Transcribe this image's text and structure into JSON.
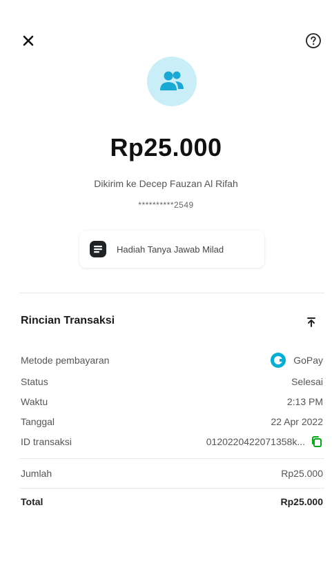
{
  "header": {
    "close_icon": "close-icon",
    "help_icon": "help-circle-icon"
  },
  "hero": {
    "avatar_icon": "people-icon",
    "avatar_color": "#c9eef8",
    "icon_color": "#1aa8d4",
    "amount": "Rp25.000",
    "recipient": "Dikirim ke Decep Fauzan Al Rifah",
    "account_masked": "**********2549"
  },
  "note": {
    "icon": "note-icon",
    "text": "Hadiah Tanya Jawab Milad"
  },
  "details": {
    "title": "Rincian Transaksi",
    "collapse_icon": "collapse-up-icon",
    "rows": [
      {
        "label": "Metode pembayaran",
        "value": "GoPay"
      },
      {
        "label": "Status",
        "value": "Selesai"
      },
      {
        "label": "Waktu",
        "value": "2:13 PM"
      },
      {
        "label": "Tanggal",
        "value": "22 Apr 2022"
      },
      {
        "label": "ID transaksi",
        "value": "0120220422071358k..."
      }
    ],
    "amount_label": "Jumlah",
    "amount_value": "Rp25.000",
    "total_label": "Total",
    "total_value": "Rp25.000"
  },
  "colors": {
    "gopay": "#00aed6",
    "copy": "#00aa13"
  }
}
